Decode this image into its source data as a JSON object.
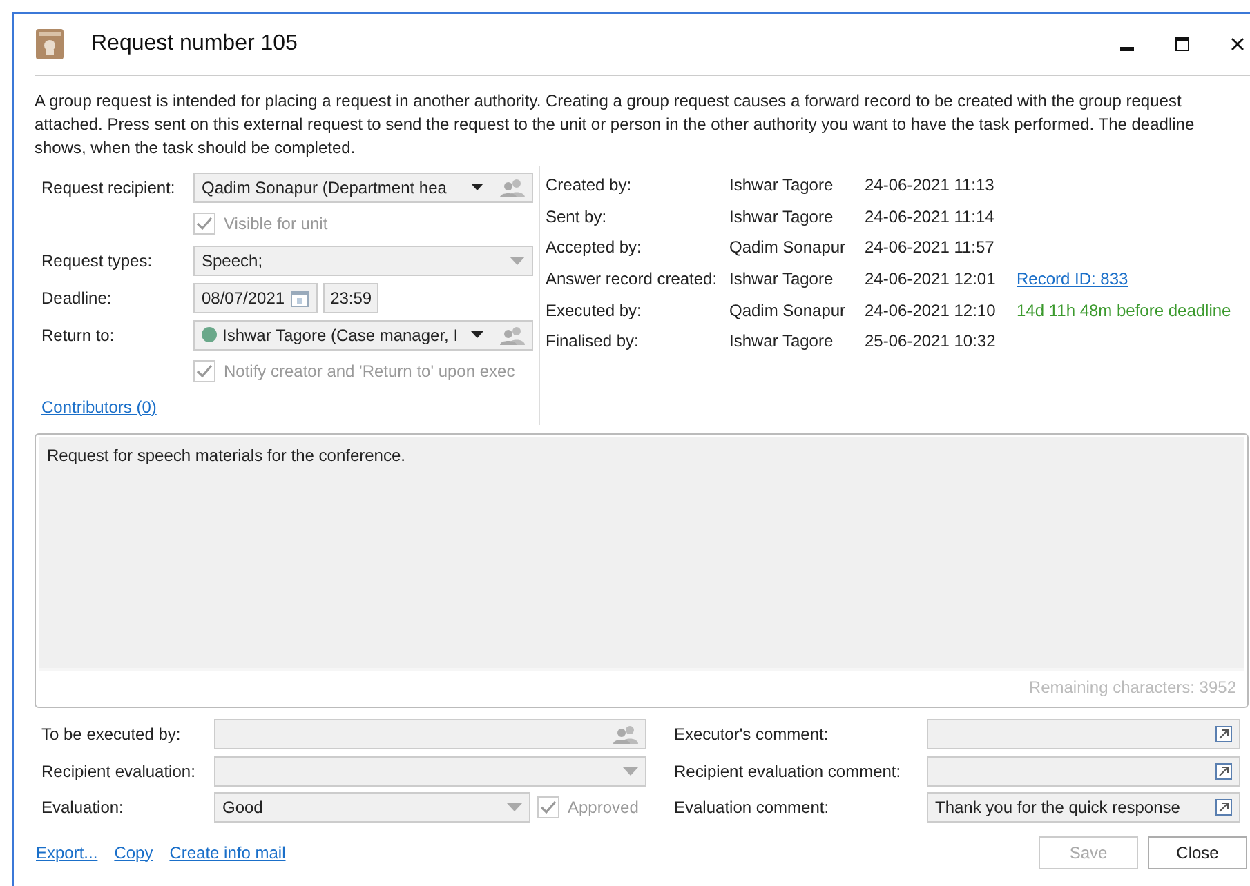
{
  "window": {
    "title": "Request number 105"
  },
  "description": "A group request is intended for placing a request in another authority. Creating a group request causes a forward record to be created with the group request attached. Press sent on this external request to send the request to the unit or person in the other authority you want to have the task performed. The deadline shows, when the task should be completed.",
  "left_form": [
    {
      "kind": "picker",
      "label": "Request recipient:",
      "value": "Qadim Sonapur (Department hea"
    },
    {
      "kind": "checkbox",
      "label": "Visible for unit",
      "checked": true,
      "disabled": true
    },
    {
      "kind": "dropdown",
      "label": "Request types:",
      "value": "Speech;"
    },
    {
      "kind": "date",
      "label": "Deadline:",
      "date": "08/07/2021",
      "time": "23:59"
    },
    {
      "kind": "picker",
      "label": "Return to:",
      "value": "Ishwar Tagore (Case manager, I",
      "color": "#6aa88a"
    },
    {
      "kind": "checkbox",
      "label": "Notify creator and 'Return to' upon exec",
      "checked": true,
      "disabled": true
    }
  ],
  "contributors_link": "Contributors (0)",
  "history": [
    {
      "label": "Created by:",
      "person": "Ishwar Tagore",
      "time": "24-06-2021 11:13"
    },
    {
      "label": "Sent by:",
      "person": "Ishwar Tagore",
      "time": "24-06-2021 11:14"
    },
    {
      "label": "Accepted by:",
      "person": "Qadim Sonapur",
      "time": "24-06-2021 11:57"
    },
    {
      "label": "Answer record created:",
      "person": "Ishwar Tagore",
      "time": "24-06-2021 12:01",
      "extra": {
        "kind": "link",
        "text": "Record ID: 833"
      }
    },
    {
      "label": "Executed by:",
      "person": "Qadim Sonapur",
      "time": "24-06-2021 12:10",
      "extra": {
        "kind": "status",
        "text": "14d 11h 48m before deadline"
      }
    },
    {
      "label": "Finalised by:",
      "person": "Ishwar Tagore",
      "time": "25-06-2021 10:32"
    }
  ],
  "comment": {
    "value": "Request for speech materials for the conference.",
    "counter": "Remaining characters: 3952"
  },
  "bottom_left": [
    {
      "kind": "picker",
      "label": "To be executed by:"
    },
    {
      "kind": "dropdown",
      "label": "Recipient evaluation:"
    },
    {
      "kind": "dropdown",
      "label": "Evaluation:",
      "value": "Good",
      "approved": {
        "label": "Approved",
        "checked": true,
        "disabled": true
      }
    }
  ],
  "bottom_right": [
    {
      "label": "Executor's comment:"
    },
    {
      "label": "Recipient evaluation comment:"
    },
    {
      "label": "Evaluation comment:",
      "value": "Thank you for the quick response"
    }
  ],
  "links": [
    "Export...",
    "Copy",
    "Create info mail"
  ],
  "buttons": [
    {
      "label": "Save",
      "disabled": true
    },
    {
      "label": "Close",
      "disabled": false
    }
  ]
}
